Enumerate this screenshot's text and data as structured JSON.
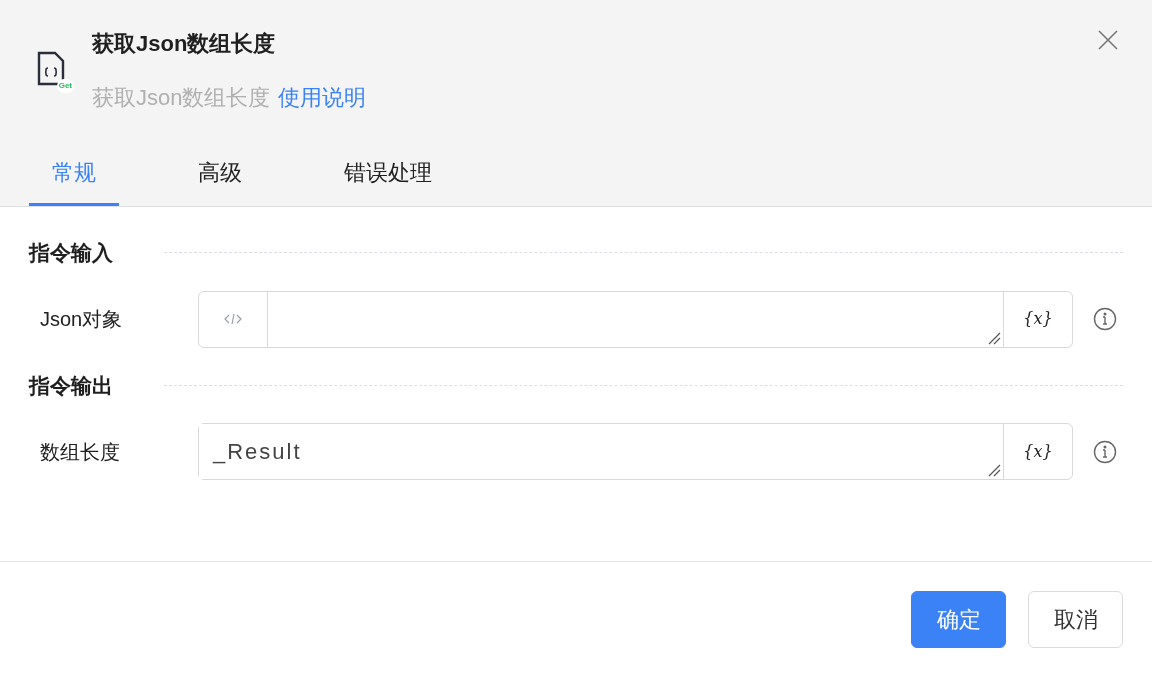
{
  "dialog": {
    "title": "获取Json数组长度",
    "subtitle": "获取Json数组长度",
    "help_link": "使用说明",
    "icon_badge": "Get"
  },
  "tabs": [
    {
      "label": "常规",
      "selected": true
    },
    {
      "label": "高级",
      "selected": false
    },
    {
      "label": "错误处理",
      "selected": false
    }
  ],
  "sections": [
    {
      "title": "指令输入",
      "fields": [
        {
          "label": "Json对象",
          "kind": "code",
          "variable_button": "{x}"
        }
      ]
    },
    {
      "title": "指令输出",
      "fields": [
        {
          "label": "数组长度",
          "kind": "text",
          "value": "_Result",
          "variable_button": "{x}"
        }
      ]
    }
  ],
  "buttons": [
    {
      "label": "确定",
      "kind": "primary"
    },
    {
      "label": "取消",
      "kind": "secondary"
    }
  ]
}
